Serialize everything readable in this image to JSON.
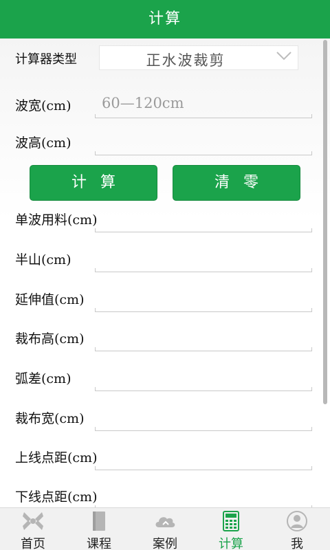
{
  "header": {
    "title": "计算"
  },
  "calculator_type": {
    "label": "计算器类型",
    "value": "正水波裁剪"
  },
  "inputs": {
    "wave_width": {
      "label": "波宽(cm)",
      "value": "",
      "placeholder": "60—120cm"
    },
    "wave_height": {
      "label": "波高(cm)",
      "value": "",
      "placeholder": ""
    }
  },
  "buttons": {
    "calculate": "计算",
    "clear": "清零"
  },
  "results": {
    "single_wave_material": {
      "label": "单波用料(cm)",
      "value": ""
    },
    "half_mountain": {
      "label": "半山(cm)",
      "value": ""
    },
    "extension": {
      "label": "延伸值(cm)",
      "value": ""
    },
    "cut_cloth_height": {
      "label": "裁布高(cm)",
      "value": ""
    },
    "arc_difference": {
      "label": "弧差(cm)",
      "value": ""
    },
    "cut_cloth_width": {
      "label": "裁布宽(cm)",
      "value": ""
    },
    "upper_line_distance": {
      "label": "上线点距(cm)",
      "value": ""
    },
    "lower_line_distance": {
      "label": "下线点距(cm)",
      "value": ""
    }
  },
  "tabbar": {
    "items": [
      {
        "label": "首页",
        "icon": "home-icon"
      },
      {
        "label": "课程",
        "icon": "book-icon"
      },
      {
        "label": "案例",
        "icon": "cloud-icon"
      },
      {
        "label": "计算",
        "icon": "calculator-icon",
        "active": true
      },
      {
        "label": "我",
        "icon": "user-icon"
      }
    ]
  },
  "colors": {
    "accent": "#1ba34b",
    "inactive_icon": "#b5b5b5"
  }
}
